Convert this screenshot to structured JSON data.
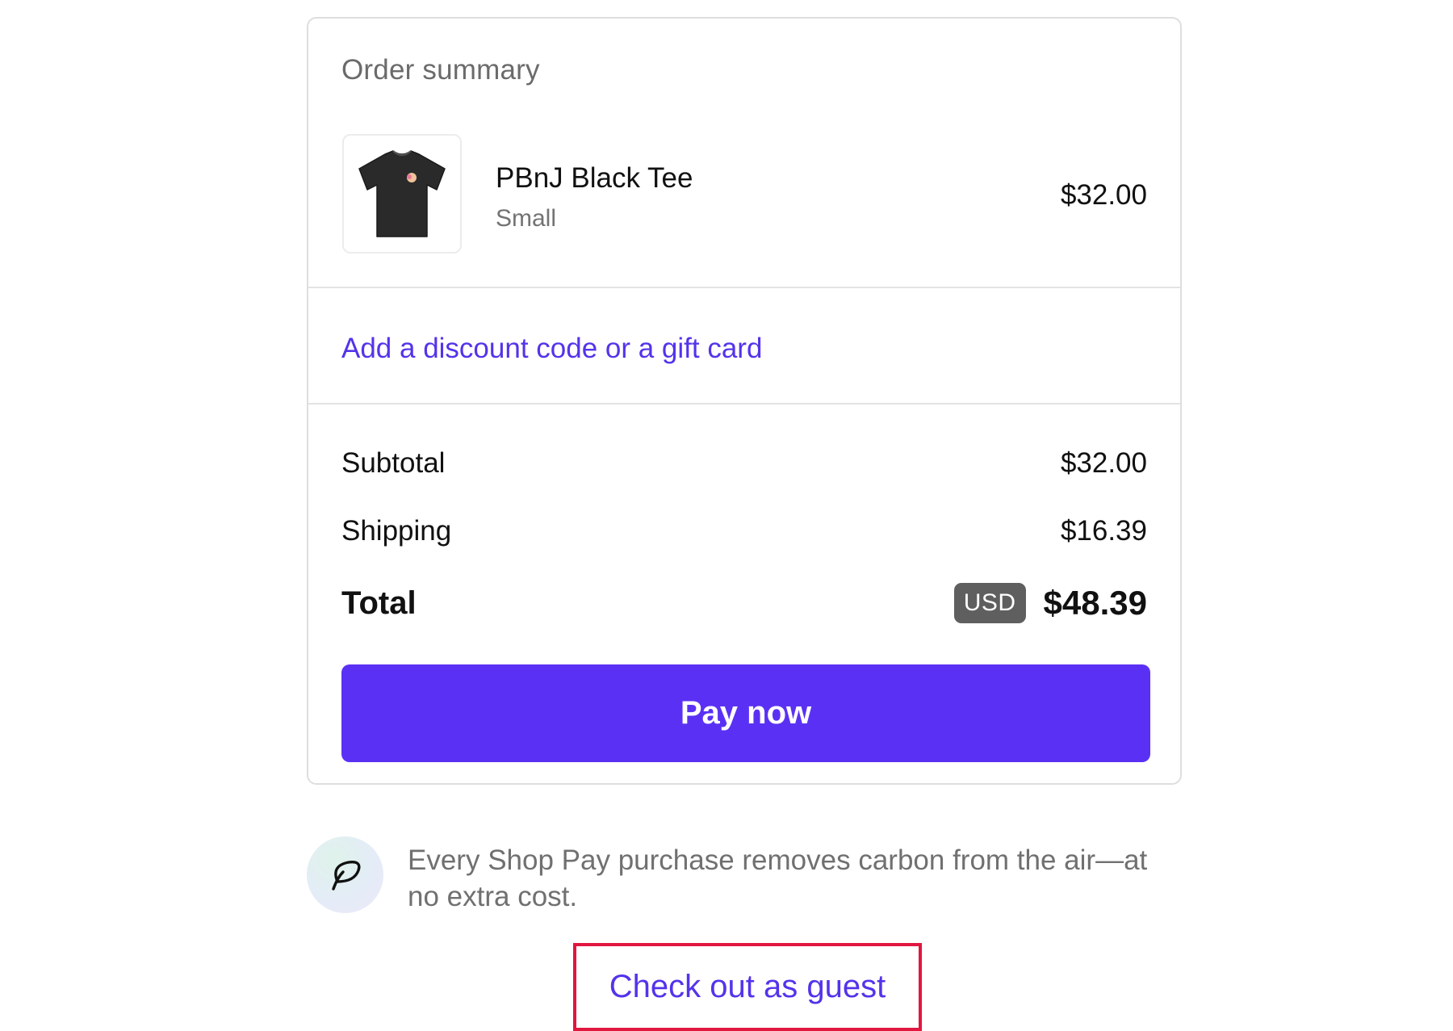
{
  "order_summary": {
    "title": "Order summary",
    "item": {
      "name": "PBnJ Black Tee",
      "variant": "Small",
      "price": "$32.00",
      "image_icon": "black-tshirt-icon"
    },
    "discount_link": "Add a discount code or a gift card",
    "subtotal": {
      "label": "Subtotal",
      "value": "$32.00"
    },
    "shipping": {
      "label": "Shipping",
      "value": "$16.39"
    },
    "total": {
      "label": "Total",
      "currency": "USD",
      "value": "$48.39"
    },
    "pay_button": "Pay now"
  },
  "carbon_note": {
    "icon": "leaf-icon",
    "text": "Every Shop Pay purchase removes carbon from the air—at no extra cost."
  },
  "guest_checkout": {
    "label": "Check out as guest",
    "highlight_color": "#e0173f"
  },
  "colors": {
    "accent": "#5a31f4",
    "link": "#5433eb",
    "badge": "#5f5f5f"
  }
}
